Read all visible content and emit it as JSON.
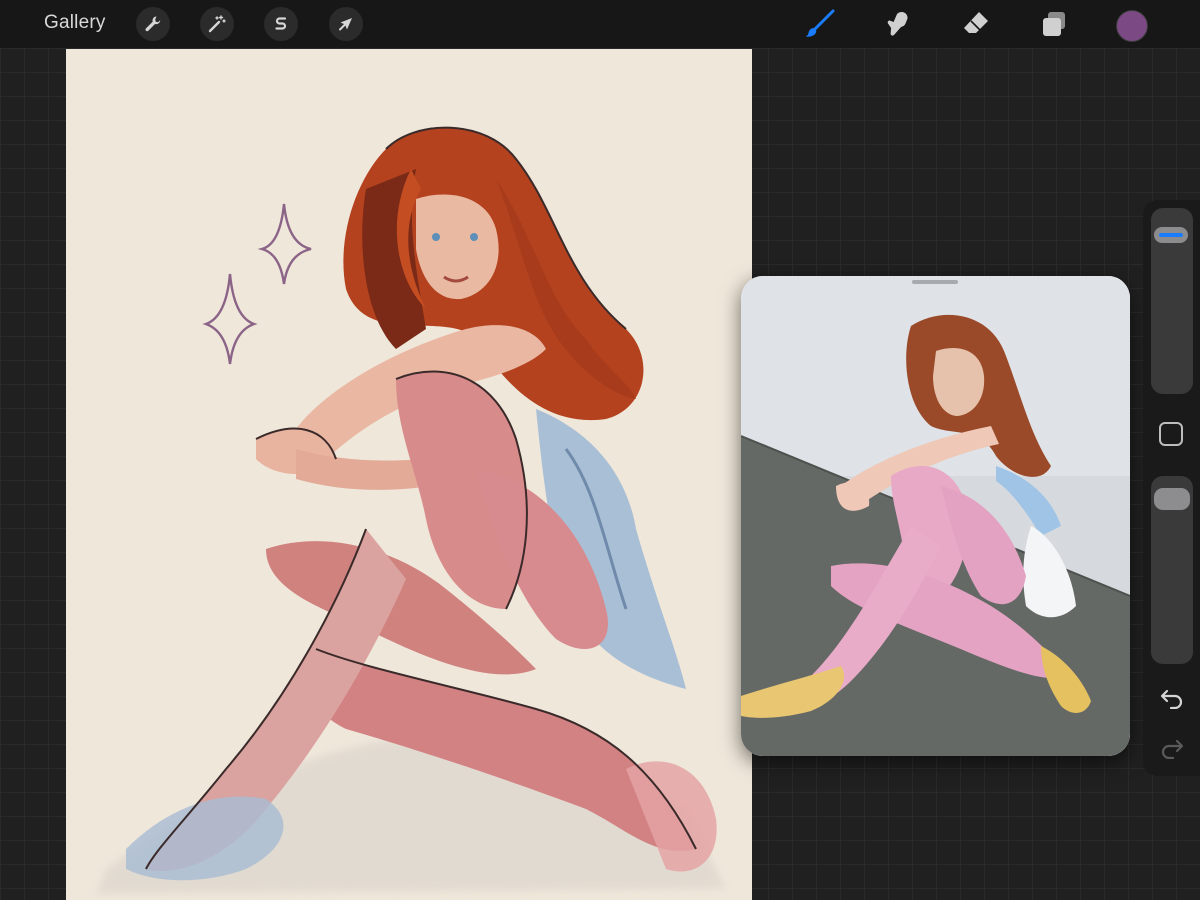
{
  "app": {
    "gallery_label": "Gallery"
  },
  "toolbar_left": [
    {
      "name": "actions",
      "icon": "wrench-icon"
    },
    {
      "name": "adjustments",
      "icon": "magic-wand-icon"
    },
    {
      "name": "selection",
      "icon": "selection-s-icon"
    },
    {
      "name": "transform",
      "icon": "arrow-cursor-icon"
    }
  ],
  "toolbar_right": [
    {
      "name": "brush",
      "icon": "brush-icon",
      "active": true
    },
    {
      "name": "smudge",
      "icon": "smudge-finger-icon",
      "active": false
    },
    {
      "name": "eraser",
      "icon": "eraser-icon",
      "active": false
    },
    {
      "name": "layers",
      "icon": "layers-icon",
      "active": false
    }
  ],
  "colors": {
    "active_color": "#7b4a84",
    "active_tool_accent": "#1a7cff",
    "canvas_paper": "#efe7da"
  },
  "sidebar": {
    "brush_size_level": 0.09,
    "opacity_level": 0.05,
    "undo_icon": "undo-arrow-icon",
    "redo_icon": "redo-arrow-icon",
    "redo_enabled": false
  }
}
